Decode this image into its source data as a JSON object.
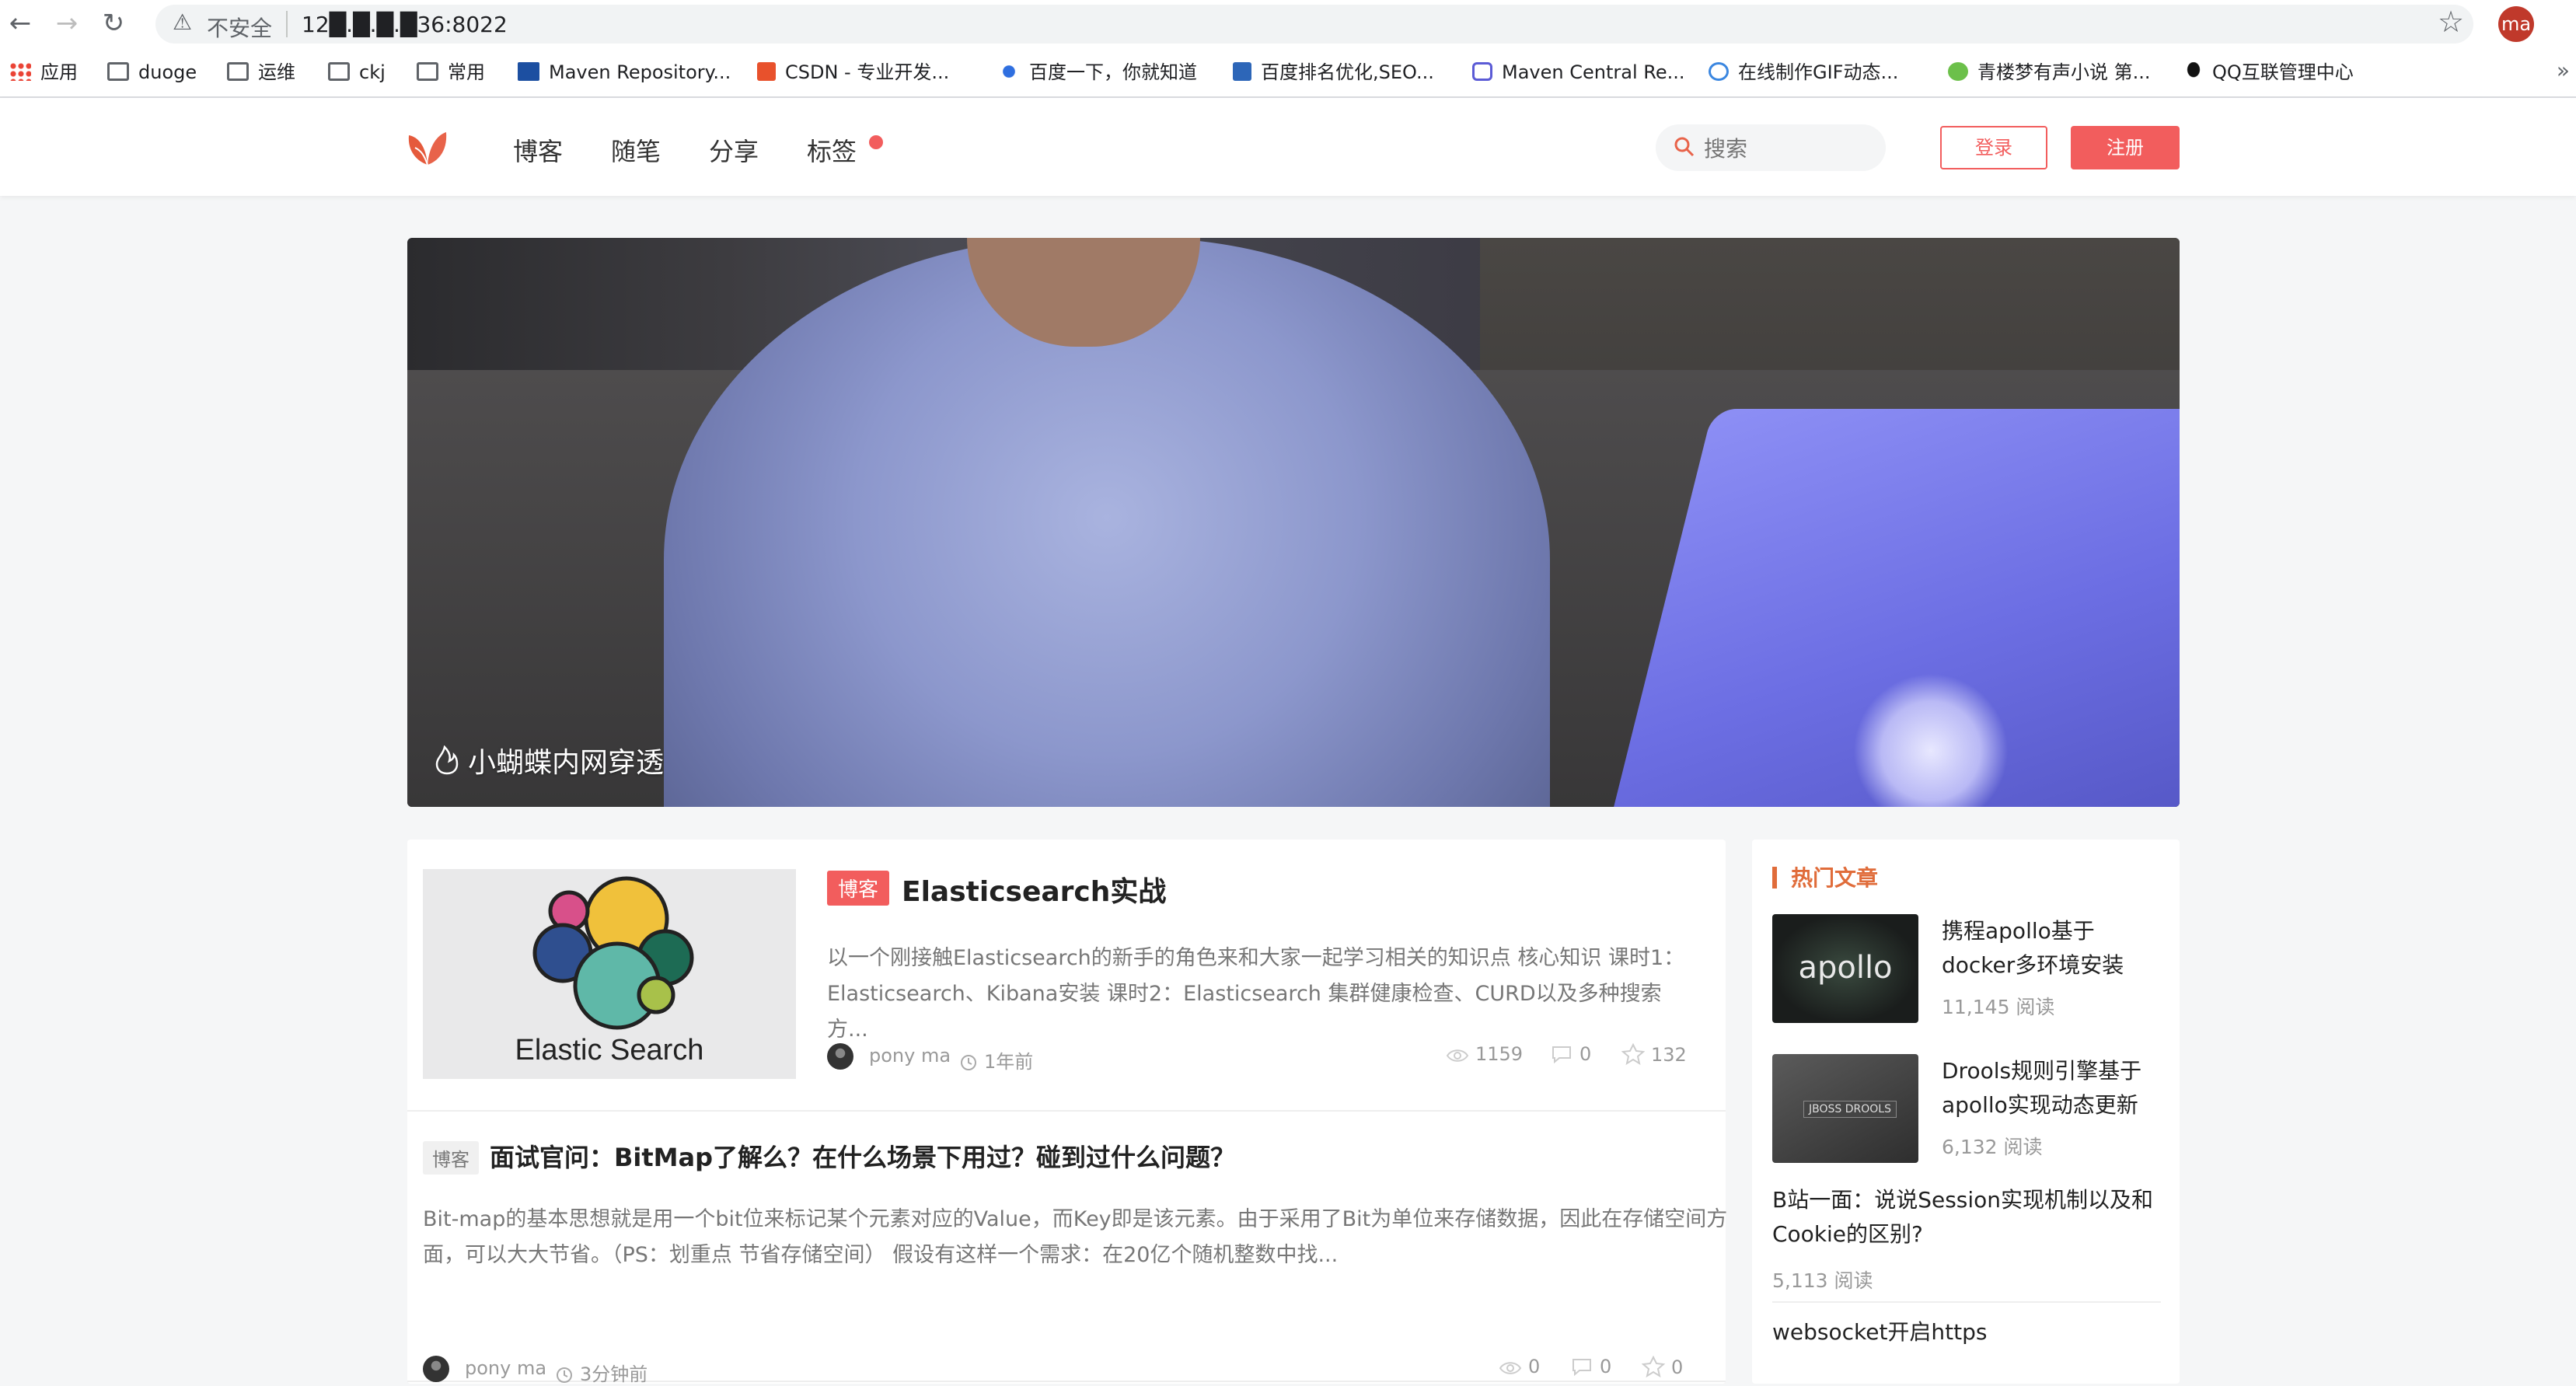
{
  "browser": {
    "insecure_label": "不安全",
    "url": "12█.█.█.█36:8022",
    "profile_initials": "ma",
    "bookmarks": [
      {
        "label": "应用",
        "icon": "apps-grid-icon"
      },
      {
        "label": "duoge",
        "icon": "folder-icon"
      },
      {
        "label": "运维",
        "icon": "folder-icon"
      },
      {
        "label": "ckj",
        "icon": "folder-icon"
      },
      {
        "label": "常用",
        "icon": "folder-icon"
      },
      {
        "label": "Maven Repository...",
        "icon": "mvn-icon"
      },
      {
        "label": "CSDN - 专业开发...",
        "icon": "csdn-icon"
      },
      {
        "label": "百度一下，你就知道",
        "icon": "baidu-icon"
      },
      {
        "label": "百度排名优化,SEO...",
        "icon": "seo-icon"
      },
      {
        "label": "Maven Central Re...",
        "icon": "hexagon-icon"
      },
      {
        "label": "在线制作GIF动态...",
        "icon": "gif-icon"
      },
      {
        "label": "青楼梦有声小说 第...",
        "icon": "leaf-icon"
      },
      {
        "label": "QQ互联管理中心",
        "icon": "qq-icon"
      }
    ],
    "more_glyph": "»"
  },
  "header": {
    "nav": [
      "博客",
      "随笔",
      "分享",
      "标签"
    ],
    "search_placeholder": "搜索",
    "login_label": "登录",
    "register_label": "注册"
  },
  "hero": {
    "caption": "小蝴蝶内网穿透"
  },
  "articles": [
    {
      "tag": "博客",
      "title": "Elasticsearch实战",
      "thumb_text": "Elastic Search",
      "summary": "以一个刚接触Elasticsearch的新手的角色来和大家一起学习相关的知识点 核心知识 课时1：Elasticsearch、Kibana安装 课时2：Elasticsearch 集群健康检查、CURD以及多种搜索方...",
      "author": "pony ma",
      "time": "1年前",
      "views": "1159",
      "comments": "0",
      "likes": "132"
    },
    {
      "tag": "博客",
      "title": "面试官问：BitMap了解么？在什么场景下用过？碰到过什么问题？",
      "summary": "Bit-map的基本思想就是用一个bit位来标记某个元素对应的Value，而Key即是该元素。由于采用了Bit为单位来存储数据，因此在存储空间方面，可以大大节省。（PS：划重点 节省存储空间） 假设有这样一个需求：在20亿个随机整数中找...",
      "author": "pony ma",
      "time": "3分钟前",
      "views": "0",
      "comments": "0",
      "likes": "0"
    }
  ],
  "sidebar": {
    "title": "热门文章",
    "items": [
      {
        "title": "携程apollo基于docker多环境安装",
        "reads": "11,145 阅读",
        "thumb_text": "apollo"
      },
      {
        "title": "Drools规则引擎基于apollo实现动态更新",
        "reads": "6,132 阅读",
        "thumb_text": "JBOSS DROOLS"
      },
      {
        "title": "B站一面：说说Session实现机制以及和Cookie的区别?",
        "reads": "5,113 阅读"
      },
      {
        "title": "websocket开启https"
      }
    ]
  },
  "colors": {
    "accent": "#f25d5d",
    "hot_title": "#e06c3a"
  }
}
